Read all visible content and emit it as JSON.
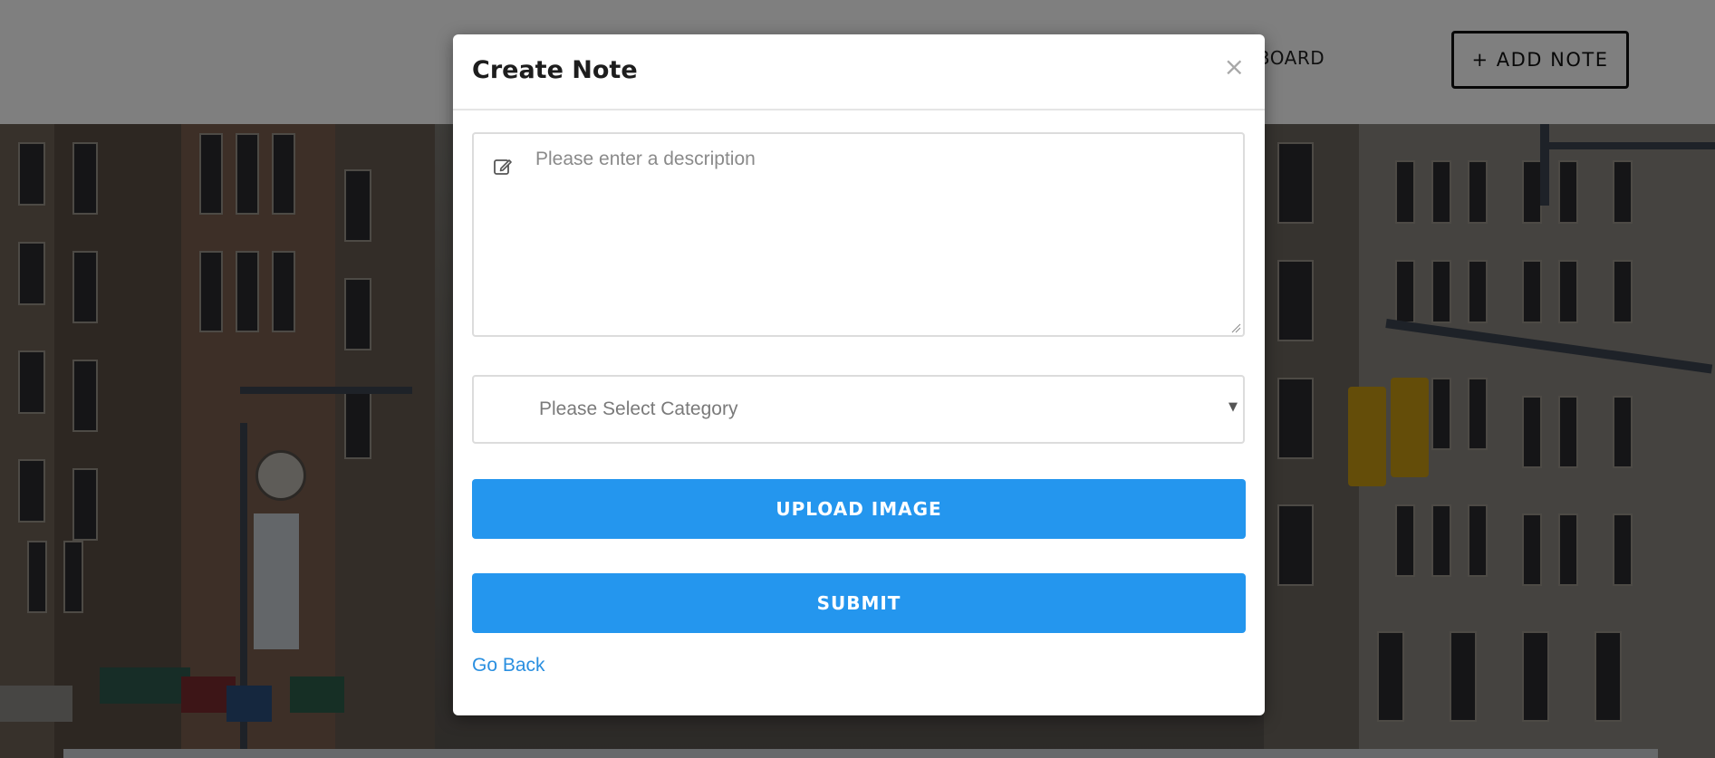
{
  "navbar": {
    "dashboard_label": "ASHBOARD",
    "add_note_label": "+ ADD NOTE"
  },
  "modal": {
    "title": "Create Note",
    "close_glyph": "×",
    "description": {
      "placeholder": "Please enter a description",
      "value": ""
    },
    "category_select": {
      "selected_label": "Please Select Category"
    },
    "upload_button_label": "UPLOAD IMAGE",
    "submit_button_label": "SUBMIT",
    "go_back_label": "Go Back"
  },
  "colors": {
    "primary_button": "#2496ee",
    "link": "#2a8fe0",
    "overlay": "rgba(0,0,0,0.5)"
  },
  "icons": {
    "description_icon": "edit-icon",
    "close": "close-icon",
    "select_caret": "chevron-down-icon"
  }
}
